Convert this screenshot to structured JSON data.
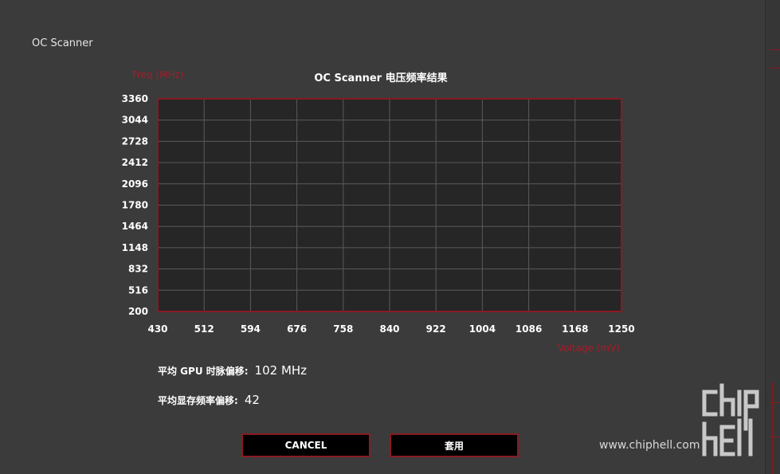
{
  "app": {
    "title": "OC Scanner"
  },
  "chart_data": {
    "type": "line",
    "title": "OC Scanner 电压频率结果",
    "xlabel": "Voltage (mV)",
    "ylabel": "Freq (MHz)",
    "x_ticks": [
      "430",
      "512",
      "594",
      "676",
      "758",
      "840",
      "922",
      "1004",
      "1086",
      "1168",
      "1250"
    ],
    "y_ticks": [
      "3360",
      "3044",
      "2728",
      "2412",
      "2096",
      "1780",
      "1464",
      "1148",
      "832",
      "516",
      "200"
    ],
    "xlim": [
      430,
      1250
    ],
    "ylim": [
      200,
      3360
    ],
    "grid": true,
    "series": []
  },
  "stats": {
    "gpu_offset_label": "平均 GPU 时脉偏移:",
    "gpu_offset_value": "102 MHz",
    "mem_offset_label": "平均显存频率偏移:",
    "mem_offset_value": "42"
  },
  "buttons": {
    "cancel_label": "CANCEL",
    "apply_label": "套用"
  },
  "watermark": {
    "site": "www.chiphell.com"
  },
  "colors": {
    "accent": "#8a1a22",
    "plot_bg": "#262626",
    "grid": "#5a5a5a"
  }
}
